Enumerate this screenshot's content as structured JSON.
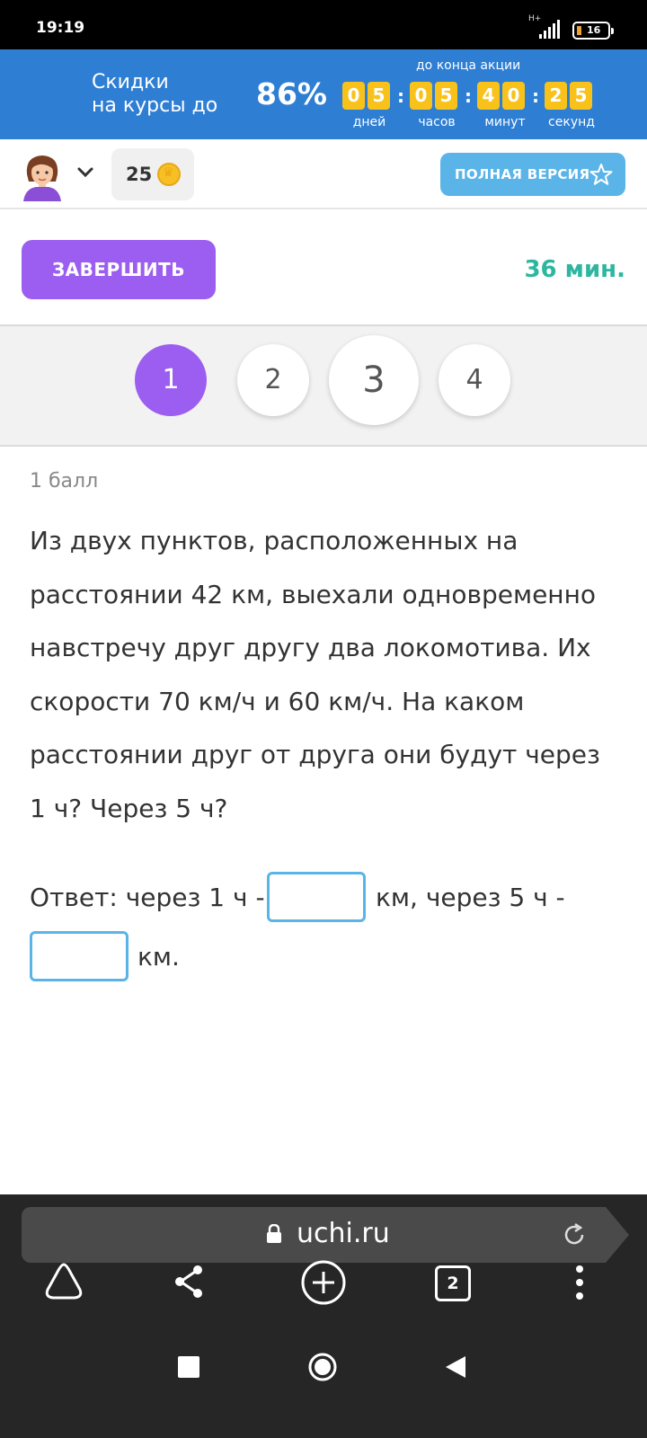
{
  "status_bar": {
    "time": "19:19",
    "network": "H+",
    "battery": "16"
  },
  "promo": {
    "line1": "Скидки",
    "line2": "на курсы до",
    "discount": "86%",
    "until_label": "до конца акции",
    "digits": [
      "0",
      "5",
      "0",
      "5",
      "4",
      "0",
      "2",
      "5"
    ],
    "units": [
      "дней",
      "часов",
      "минут",
      "секунд"
    ]
  },
  "header": {
    "coins": "25",
    "full_version_label": "ПОЛНАЯ ВЕРСИЯ"
  },
  "controls": {
    "finish_label": "ЗАВЕРШИТЬ",
    "timer": "36 мин."
  },
  "pager": {
    "pages": [
      "1",
      "2",
      "3",
      "4"
    ],
    "active": 1
  },
  "task": {
    "points": "1 балл",
    "question": "Из двух пунктов, расположенных на расстоянии 42 км, выехали одновременно навстречу друг другу два локомотива. Их скорости 70 км/ч и 60 км/ч. На каком расстоянии друг от друга они будут через 1 ч? Через 5 ч?",
    "answer_prefix": "Ответ: через 1 ч -",
    "answer_middle": "км, через 5 ч -",
    "answer_suffix": "км."
  },
  "browser": {
    "url": "uchi.ru",
    "tab_count": "2"
  },
  "colors": {
    "promo_bg": "#2e7ed4",
    "accent_purple": "#9b5ef0",
    "accent_blue": "#5ab4e8",
    "timer_green": "#2db7a0",
    "countdown_yellow": "#f8c21b"
  }
}
